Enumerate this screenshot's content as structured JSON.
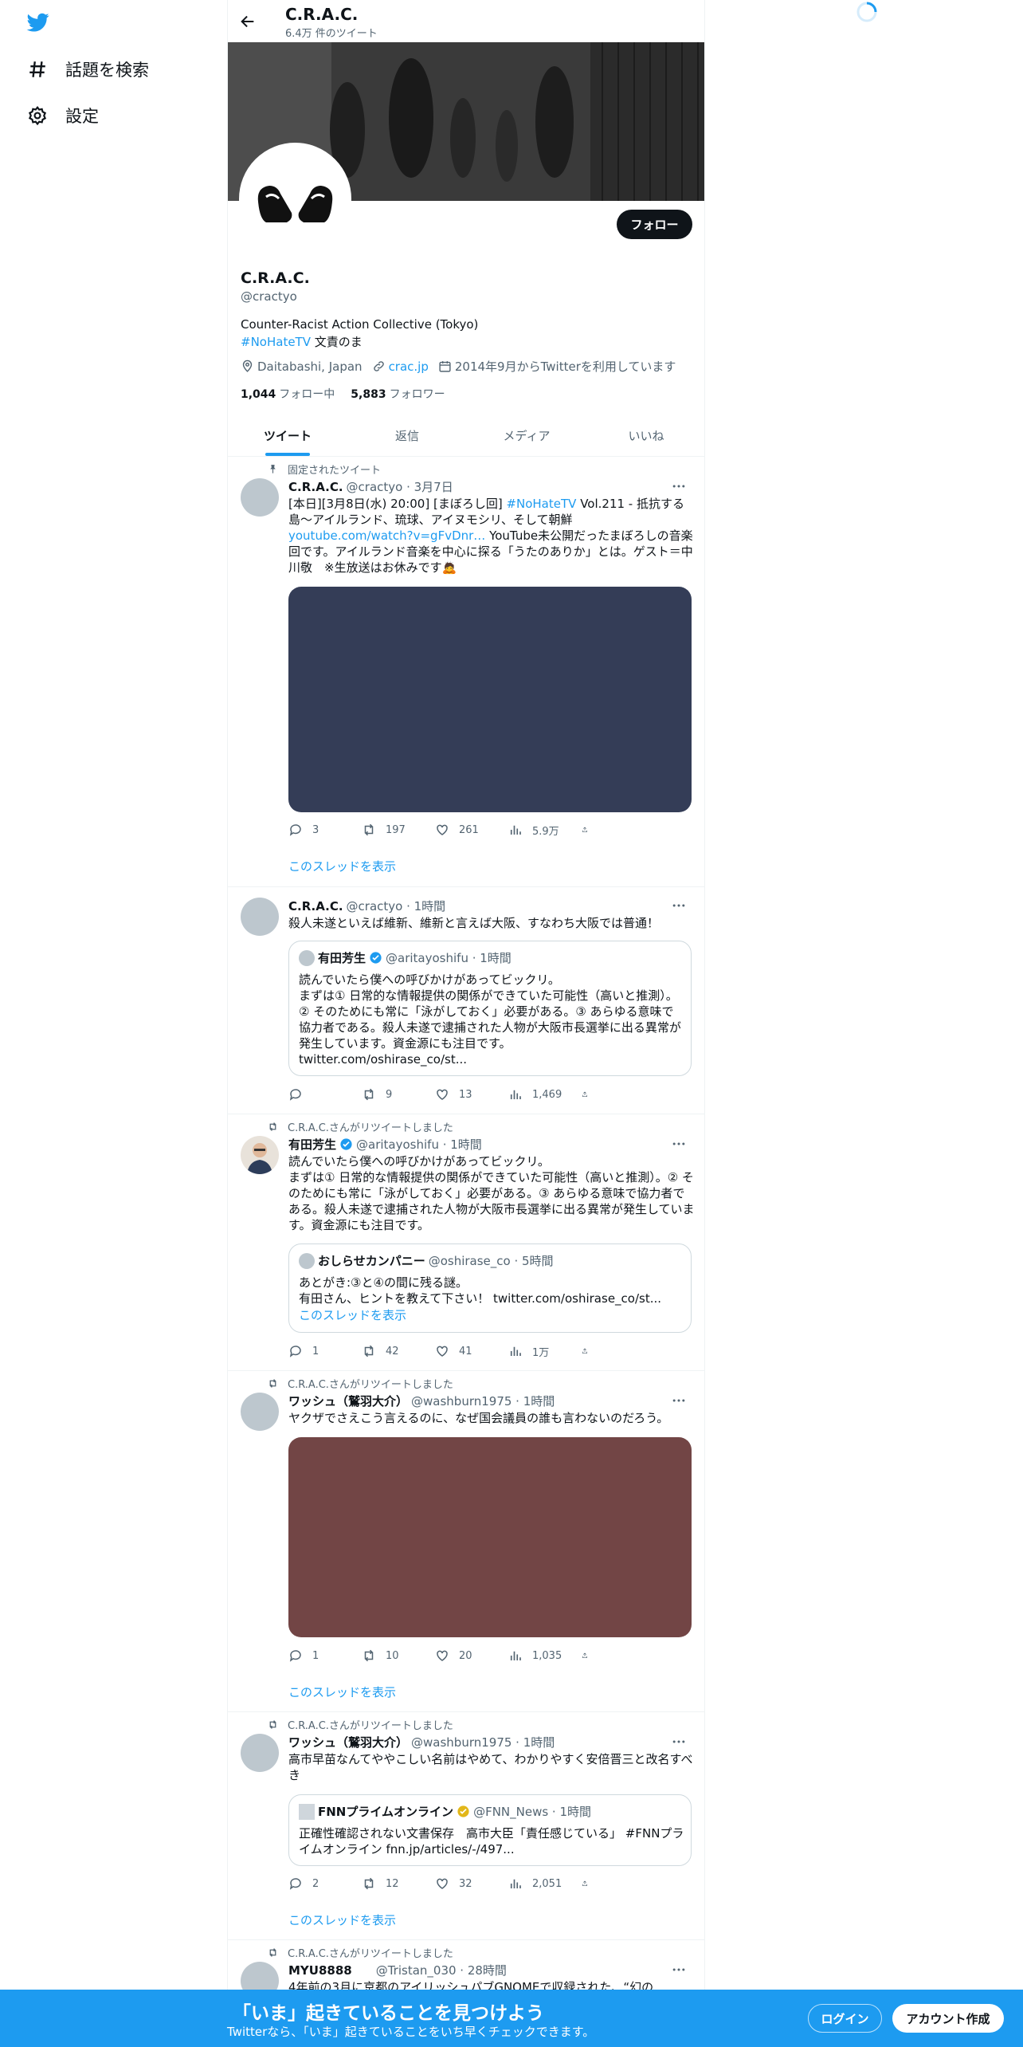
{
  "nav": {
    "explore_label": "話題を検索",
    "settings_label": "設定"
  },
  "colors": {
    "accent": "#1d9bf0",
    "text": "#0f1419",
    "muted": "#536471"
  },
  "topbar": {
    "title": "C.R.A.C.",
    "tweet_count": "6.4万 件のツイート"
  },
  "profile": {
    "follow_label": "フォロー",
    "name": "C.R.A.C.",
    "handle": "@cractyo",
    "bio_line1": "Counter-Racist Action Collective (Tokyo)",
    "bio_hashtag": "#NoHateTV",
    "bio_rest": " 文責のま",
    "location": "Daitabashi, Japan",
    "website": "crac.jp",
    "joined": "2014年9月からTwitterを利用しています",
    "following_count": "1,044",
    "following_label": "フォロー中",
    "followers_count": "5,883",
    "followers_label": "フォロワー"
  },
  "tabs": [
    "ツイート",
    "返信",
    "メディア",
    "いいね"
  ],
  "tweets": [
    {
      "context": "固定されたツイート",
      "name": "C.R.A.C.",
      "handle_time": "@cractyo · 3月7日",
      "text_a": "[本日][3月8日(水) 20:00] [まぼろし回] ",
      "text_hashtag": "#NoHateTV",
      "text_b": " Vol.211 - 抵抗する島〜アイルランド、琉球、アイヌモシリ、そして朝鮮 ",
      "text_link": "youtube.com/watch?v=gFvDnr…",
      "text_c": " YouTube未公開だったまぼろしの音楽回です。アイルランド音楽を中心に探る「うたのありか」とは。ゲスト＝中川敬　※生放送はお休みです🙇",
      "media_color": "#343d57",
      "replies": "3",
      "retweets": "197",
      "likes": "261",
      "views": "5.9万",
      "thread_link": "このスレッドを表示"
    },
    {
      "name": "C.R.A.C.",
      "handle_time": "@cractyo · 1時間",
      "text": "殺人未遂といえば維新、維新と言えば大阪、すなわち大阪では普通！",
      "quote_name": "有田芳生",
      "quote_handle_time": "@aritayoshifu · 1時間",
      "quote_text": "読んでいたら僕への呼びかけがあってビックリ。\nまずは① 日常的な情報提供の関係ができていた可能性（高いと推測）。② そのためにも常に「泳がしておく」必要がある。③ あらゆる意味で協力者である。殺人未遂で逮捕された人物が大阪市長選挙に出る異常が発生しています。資金源にも注目です。\ntwitter.com/oshirase_co/st...",
      "replies": "",
      "retweets": "9",
      "likes": "13",
      "views": "1,469"
    },
    {
      "context": "C.R.A.C.さんがリツイートしました",
      "name": "有田芳生",
      "handle_time": "@aritayoshifu · 1時間",
      "text": "読んでいたら僕への呼びかけがあってビックリ。\nまずは① 日常的な情報提供の関係ができていた可能性（高いと推測）。② そのためにも常に「泳がしておく」必要がある。③ あらゆる意味で協力者である。殺人未遂で逮捕された人物が大阪市長選挙に出る異常が発生しています。資金源にも注目です。",
      "quote_name": "おしらせカンパニー",
      "quote_handle_time": "@oshirase_co · 5時間",
      "quote_text": "あとがき:③と④の間に残る謎。\n有田さん、ヒントを教えて下さい！ twitter.com/oshirase_co/st...",
      "quote_thread": "このスレッドを表示",
      "replies": "1",
      "retweets": "42",
      "likes": "41",
      "views": "1万"
    },
    {
      "context": "C.R.A.C.さんがリツイートしました",
      "name": "ワッシュ（鷲羽大介）",
      "handle_time": "@washburn1975 · 1時間",
      "text": "ヤクザでさえこう言えるのに、なぜ国会議員の誰も言わないのだろう。",
      "media_color": "#724545",
      "replies": "1",
      "retweets": "10",
      "likes": "20",
      "views": "1,035",
      "thread_link": "このスレッドを表示"
    },
    {
      "context": "C.R.A.C.さんがリツイートしました",
      "name": "ワッシュ（鷲羽大介）",
      "handle_time": "@washburn1975 · 1時間",
      "text": "高市早苗なんてややこしい名前はやめて、わかりやすく安倍晋三と改名すべき",
      "quote_name": "FNNプライムオンライン",
      "quote_handle_time": "@FNN_News · 1時間",
      "quote_text": "正確性確認されない文書保存　高市大臣「責任感じている」 #FNNプライムオンライン fnn.jp/articles/-/497...",
      "replies": "2",
      "retweets": "12",
      "likes": "32",
      "views": "2,051",
      "thread_link": "このスレッドを表示"
    },
    {
      "context": "C.R.A.C.さんがリツイートしました",
      "name": "MYU8888",
      "handle_time": "@Tristan_030 · 28時間",
      "text": "4年前の3月に京都のアイリッシュパブGNOMEで収録された、“幻の..."
    }
  ],
  "bottom": {
    "title": "「いま」起きていることを見つけよう",
    "subtitle": "Twitterなら、「いま」起きていることをいち早くチェックできます。",
    "login": "ログイン",
    "signup": "アカウント作成"
  }
}
